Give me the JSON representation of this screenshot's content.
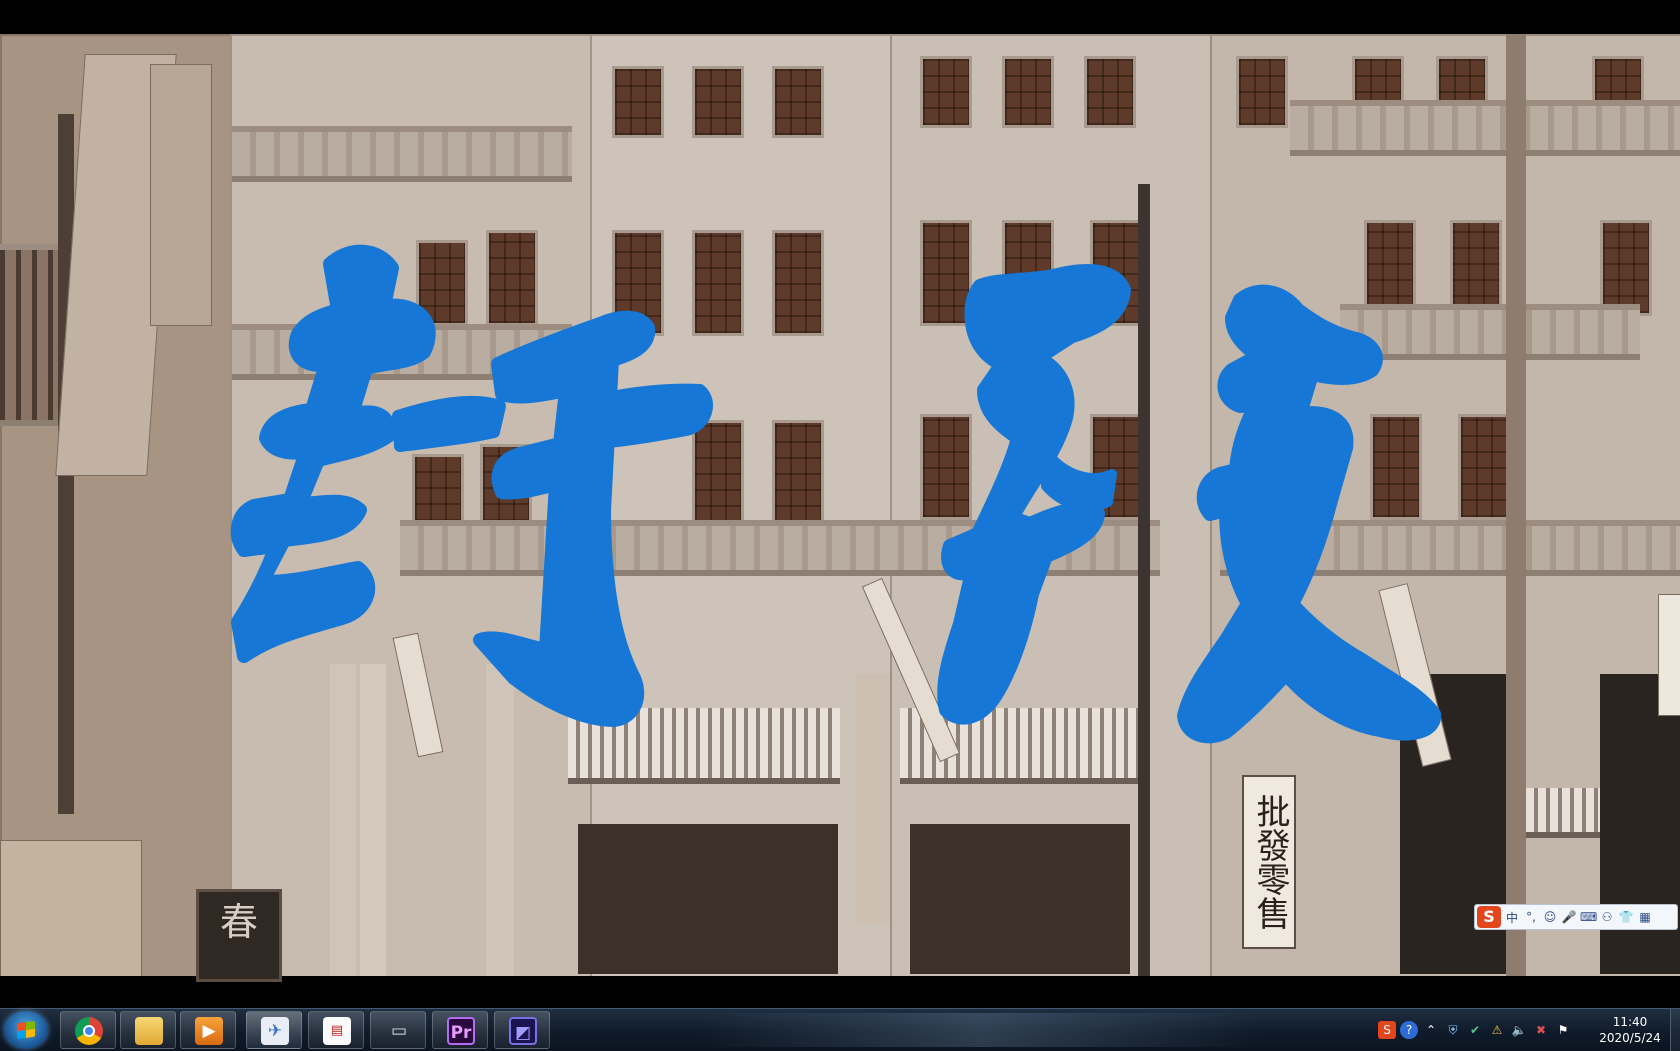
{
  "video": {
    "overlay_title": "封锁",
    "overlay_color": "#1677d6",
    "shop_sign_text": "批發零售",
    "spring_sign_text": "春"
  },
  "ime_toolbar": {
    "logo": "S",
    "mode": "中",
    "punct": "°,",
    "items": [
      "emoji-icon",
      "microphone-icon",
      "keyboard-icon",
      "user-icon",
      "skin-icon",
      "grid-icon"
    ]
  },
  "taskbar": {
    "apps": [
      {
        "name": "chrome-icon",
        "label": ""
      },
      {
        "name": "file-explorer-icon",
        "label": ""
      },
      {
        "name": "media-player-icon",
        "label": ""
      },
      {
        "name": "app-icon",
        "label": ""
      },
      {
        "name": "app-icon-2",
        "label": ""
      },
      {
        "name": "video-call-icon",
        "label": ""
      },
      {
        "name": "premiere-icon",
        "label": "Pr"
      },
      {
        "name": "media-encoder-icon",
        "label": ""
      }
    ],
    "clock_time": "11:40",
    "clock_date": "2020/5/24"
  }
}
